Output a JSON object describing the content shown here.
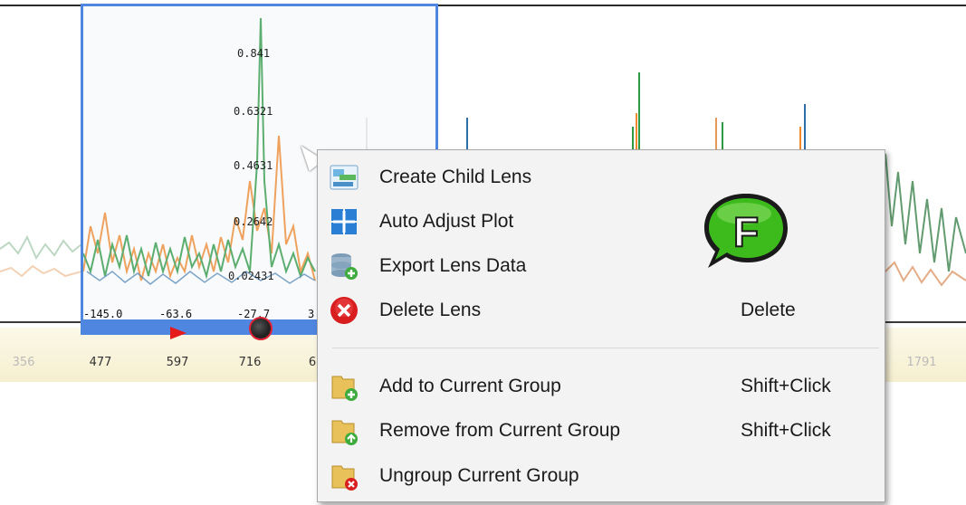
{
  "lens": {
    "y_ticks": [
      "0.841",
      "0.6321",
      "0.4631",
      "0.2642",
      "0.02431"
    ],
    "x_ticks": [
      "-145.0",
      "-63.6",
      "-27.7",
      "3"
    ]
  },
  "axis_ticks": [
    "356",
    "477",
    "597",
    "716",
    "6",
    "1791"
  ],
  "context_menu": {
    "items": [
      {
        "label": "Create Child Lens",
        "shortcut": "",
        "icon": "child-lens-icon"
      },
      {
        "label": "Auto Adjust Plot",
        "shortcut": "",
        "icon": "auto-adjust-icon"
      },
      {
        "label": "Export Lens Data",
        "shortcut": "",
        "icon": "export-data-icon"
      },
      {
        "label": "Delete Lens",
        "shortcut": "Delete",
        "icon": "delete-icon"
      },
      {
        "label": "Add to Current Group",
        "shortcut": "Shift+Click",
        "icon": "add-group-icon"
      },
      {
        "label": "Remove from Current Group",
        "shortcut": "Shift+Click",
        "icon": "remove-group-icon"
      },
      {
        "label": "Ungroup Current Group",
        "shortcut": "",
        "icon": "ungroup-icon"
      }
    ]
  },
  "badge": {
    "letter": "F"
  },
  "colors": {
    "lens_border": "#4f86e0",
    "series_green": "#2e9a44",
    "series_orange": "#f08a2c",
    "series_blue": "#2f6fa8",
    "badge_green": "#3dbb1d"
  }
}
